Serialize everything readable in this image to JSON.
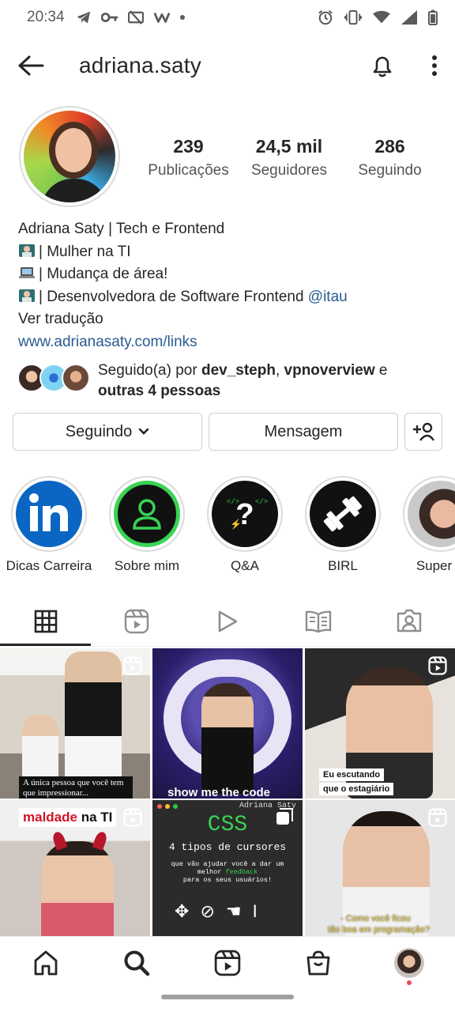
{
  "status_bar": {
    "time": "20:34"
  },
  "header": {
    "username": "adriana.saty"
  },
  "stats": [
    {
      "value": "239",
      "label": "Publicações"
    },
    {
      "value": "24,5 mil",
      "label": "Seguidores"
    },
    {
      "value": "286",
      "label": "Seguindo"
    }
  ],
  "bio": {
    "name_line": "Adriana Saty | Tech e Frontend",
    "line1": "| Mulher na TI",
    "line2": "| Mudança de área!",
    "line3": "| Desenvolvedora de Software Frontend",
    "line3_mention": "@itau",
    "translate": "Ver tradução",
    "link": "www.adrianasaty.com/links"
  },
  "followed_by": {
    "prefix": "Seguido(a) por",
    "user1": "dev_steph",
    "user2": "vpnoverview",
    "connector": "e",
    "others": "outras 4 pessoas"
  },
  "actions": {
    "following": "Seguindo",
    "message": "Mensagem"
  },
  "highlights": [
    {
      "label": "Dicas Carreira"
    },
    {
      "label": "Sobre mim"
    },
    {
      "label": "Q&A"
    },
    {
      "label": "BIRL"
    },
    {
      "label": "Super D"
    }
  ],
  "grid": {
    "post1_caption": "A única pessoa que você tem que impressionar...",
    "post2_caption": "show me the code",
    "post3_caption_line1": "Eu escutando",
    "post3_caption_line2": "que o estagiário",
    "post4_caption_part1": "maldade",
    "post4_caption_part2": "na TI",
    "post5_author": "Adriana Saty",
    "post5_title": "CSS",
    "post5_subtitle": "4 tipos de cursores",
    "post5_desc1": "que vão ajudar você a dar um",
    "post5_desc2": "melhor",
    "post5_desc2_green": "feedback",
    "post5_desc3": "para os seus usuários!",
    "post6_caption_line1": "- Como você ficou",
    "post6_caption_line2": "tão boa em programação?"
  },
  "colors": {
    "link": "#2a5b8f",
    "linkedin": "#0a66c2",
    "notification_dot": "#ed4956"
  }
}
